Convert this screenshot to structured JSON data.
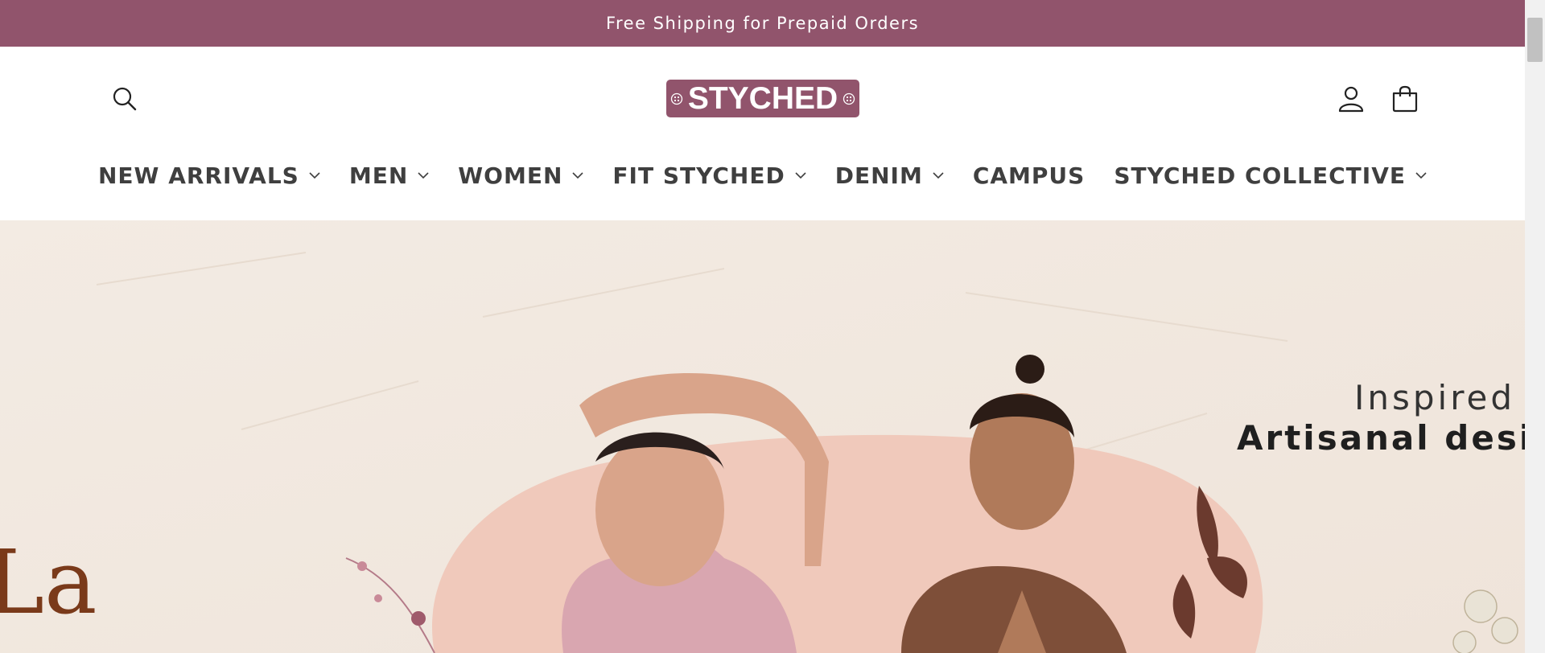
{
  "announcement": {
    "text": "Free Shipping for Prepaid Orders"
  },
  "header": {
    "logo_text": "STYCHED",
    "icons": {
      "search": "search-icon",
      "account": "account-icon",
      "cart": "cart-icon"
    }
  },
  "nav": {
    "items": [
      {
        "label": "NEW ARRIVALS",
        "has_dropdown": true
      },
      {
        "label": "MEN",
        "has_dropdown": true
      },
      {
        "label": "WOMEN",
        "has_dropdown": true
      },
      {
        "label": "FIT STYCHED",
        "has_dropdown": true
      },
      {
        "label": "DENIM",
        "has_dropdown": true
      },
      {
        "label": "CAMPUS",
        "has_dropdown": false
      },
      {
        "label": "STYCHED COLLECTIVE",
        "has_dropdown": true
      }
    ]
  },
  "hero": {
    "line1": "Inspired b",
    "line2": "Artisanal design",
    "script": "La"
  },
  "colors": {
    "brand": "#91546c",
    "hero_bg": "#f1e8df",
    "nav_text": "#3f3f3f"
  }
}
